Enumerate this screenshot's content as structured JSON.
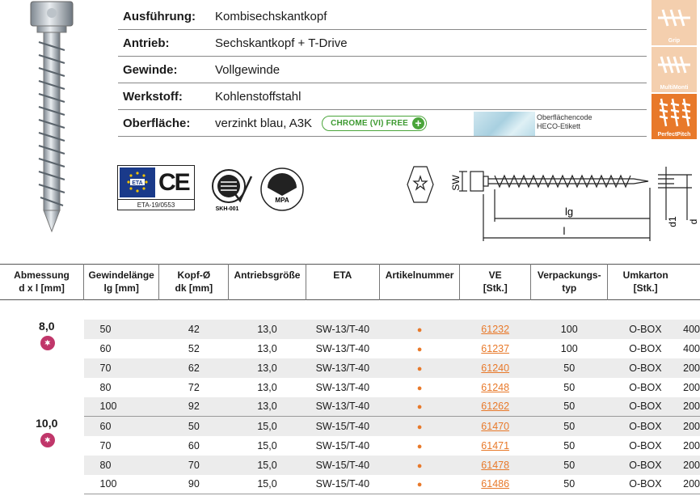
{
  "specs": [
    {
      "key": "Ausführung:",
      "value": "Kombisechskantkopf"
    },
    {
      "key": "Antrieb:",
      "value": "Sechskantkopf + T-Drive"
    },
    {
      "key": "Gewinde:",
      "value": "Vollgewinde"
    },
    {
      "key": "Werkstoff:",
      "value": "Kohlenstoffstahl"
    },
    {
      "key": "Oberfläche:",
      "value": "verzinkt blau, A3K"
    }
  ],
  "chrome_badge": "CHROME (VI) FREE",
  "coating_text": {
    "line1": "Oberflächencode",
    "line2": "HECO-Etikett"
  },
  "thread_icons": [
    {
      "label": "Grip",
      "state": "faded"
    },
    {
      "label": "MultiMonti",
      "state": "faded"
    },
    {
      "label": "PerfectPitch",
      "state": "active"
    }
  ],
  "certs": {
    "eta": "ETA-19/0553",
    "ce": "CE",
    "skh": "SKH-001",
    "skh_top": "SKH",
    "mpa": "MPA"
  },
  "drawing": {
    "sw": "SW",
    "lg": "lg",
    "l": "l",
    "d1": "d1",
    "d": "d"
  },
  "colors": {
    "orange": "#e8792a",
    "torx": "#c0366a",
    "green": "#4aa53a"
  },
  "table": {
    "headers": [
      {
        "l1": "Abmessung",
        "l2": "d x l [mm]"
      },
      {
        "l1": "Gewindelänge",
        "l2": "lg [mm]"
      },
      {
        "l1": "Kopf-Ø",
        "l2": "dk [mm]"
      },
      {
        "l1": "Antriebsgröße",
        "l2": ""
      },
      {
        "l1": "ETA",
        "l2": ""
      },
      {
        "l1": "Artikelnummer",
        "l2": ""
      },
      {
        "l1": "VE",
        "l2": "[Stk.]"
      },
      {
        "l1": "Verpackungs-",
        "l2": "typ"
      },
      {
        "l1": "Umkarton",
        "l2": "[Stk.]"
      }
    ],
    "groups": [
      {
        "diameter": "8,0",
        "rows": [
          {
            "l": "50",
            "lg": "42",
            "dk": "13,0",
            "drive": "SW-13/T-40",
            "art": "61232",
            "ve": "100",
            "typ": "O-BOX",
            "uk": "400"
          },
          {
            "l": "60",
            "lg": "52",
            "dk": "13,0",
            "drive": "SW-13/T-40",
            "art": "61237",
            "ve": "100",
            "typ": "O-BOX",
            "uk": "400"
          },
          {
            "l": "70",
            "lg": "62",
            "dk": "13,0",
            "drive": "SW-13/T-40",
            "art": "61240",
            "ve": "50",
            "typ": "O-BOX",
            "uk": "200"
          },
          {
            "l": "80",
            "lg": "72",
            "dk": "13,0",
            "drive": "SW-13/T-40",
            "art": "61248",
            "ve": "50",
            "typ": "O-BOX",
            "uk": "200"
          },
          {
            "l": "100",
            "lg": "92",
            "dk": "13,0",
            "drive": "SW-13/T-40",
            "art": "61262",
            "ve": "50",
            "typ": "O-BOX",
            "uk": "200"
          }
        ]
      },
      {
        "diameter": "10,0",
        "rows": [
          {
            "l": "60",
            "lg": "50",
            "dk": "15,0",
            "drive": "SW-15/T-40",
            "art": "61470",
            "ve": "50",
            "typ": "O-BOX",
            "uk": "200"
          },
          {
            "l": "70",
            "lg": "60",
            "dk": "15,0",
            "drive": "SW-15/T-40",
            "art": "61471",
            "ve": "50",
            "typ": "O-BOX",
            "uk": "200"
          },
          {
            "l": "80",
            "lg": "70",
            "dk": "15,0",
            "drive": "SW-15/T-40",
            "art": "61478",
            "ve": "50",
            "typ": "O-BOX",
            "uk": "200"
          },
          {
            "l": "100",
            "lg": "90",
            "dk": "15,0",
            "drive": "SW-15/T-40",
            "art": "61486",
            "ve": "50",
            "typ": "O-BOX",
            "uk": "200"
          }
        ]
      }
    ]
  }
}
